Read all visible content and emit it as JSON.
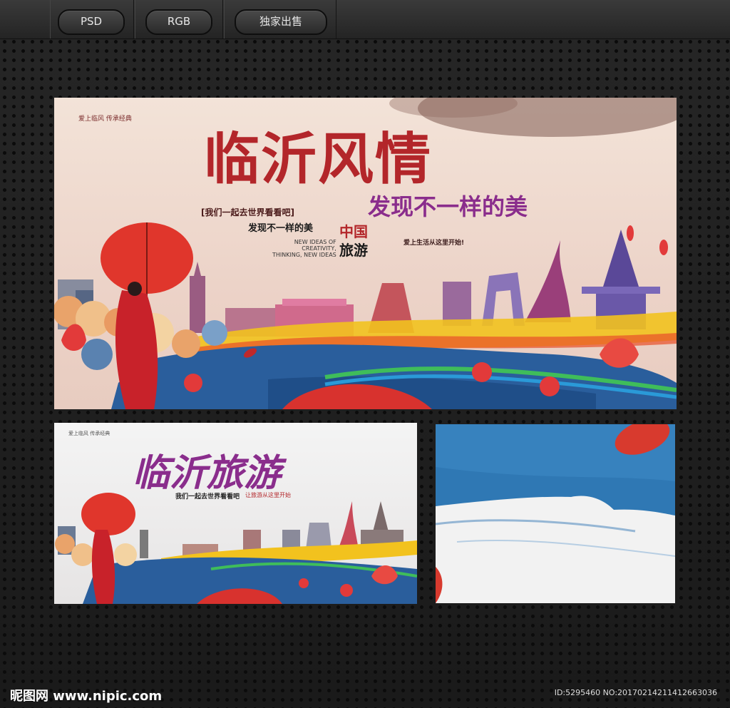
{
  "toolbar": {
    "tabs": [
      {
        "label": "PSD"
      },
      {
        "label": "RGB"
      },
      {
        "label": "独家出售"
      }
    ]
  },
  "main_banner": {
    "top_tagline": "爱上临风 传承经典",
    "title": "临沂风情",
    "subtitle": "发现不一样的美",
    "slogan": "[我们一起去世界看看吧]",
    "discover": "发现不一样的美",
    "en_lines": [
      "NEW IDEAS OF",
      "CREATIVITY,",
      "THINKING, NEW IDEAS"
    ],
    "china_label": "中国",
    "travel_label": "旅游",
    "side_text": "爱上生活从这里开始!"
  },
  "small_banner": {
    "top_tagline": "爱上临风 传承经典",
    "title": "临沂旅游",
    "slogan": "我们一起去世界看看吧",
    "side_text": "让旅游从这里开始"
  },
  "footer": {
    "site": "昵图网 www.nipic.com",
    "id_text": "ID:5295460 NO:20170214211412663036"
  },
  "colors": {
    "title_red": "#b3262a",
    "title_purple": "#8a2d8c",
    "wave_blue": "#2a5e9c",
    "umbrella_red": "#e0362c"
  }
}
